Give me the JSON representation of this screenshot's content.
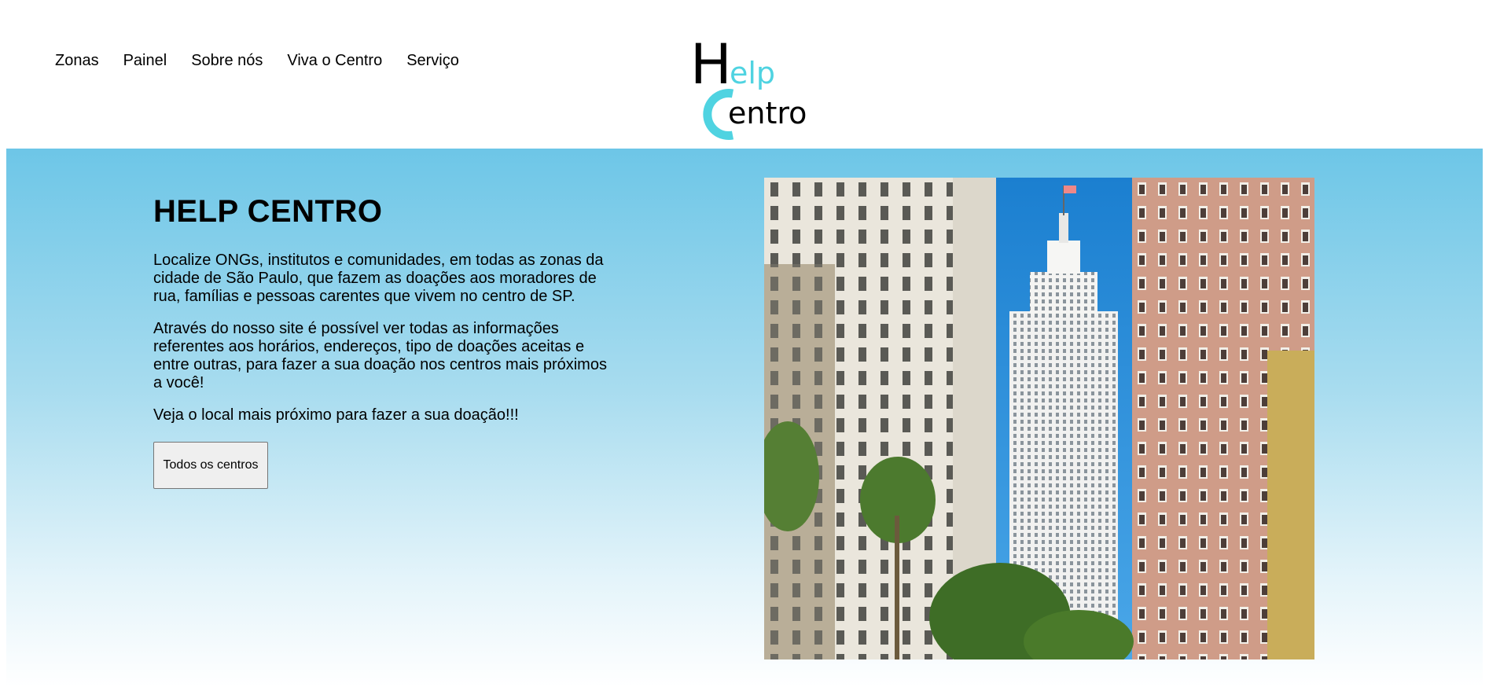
{
  "nav": {
    "items": [
      "Zonas",
      "Painel",
      "Sobre nós",
      "Viva o Centro",
      "Serviço"
    ]
  },
  "logo": {
    "line1_initial": "H",
    "line1_rest": "elp",
    "line2_initial": "C",
    "line2_rest": "entro",
    "accent_color": "#4fd3e1"
  },
  "hero": {
    "title": "HELP CENTRO",
    "paragraphs": [
      "Localize ONGs, institutos e comunidades, em todas as zonas da cidade de São Paulo, que fazem as doações aos moradores de rua, famílias e pessoas carentes que vivem no centro de SP.",
      "Através do nosso site é possível ver todas as informações referentes aos horários, endereços, tipo de doações aceitas e entre outras, para fazer a sua doação nos centros mais próximos a você!",
      "Veja o local mais próximo para fazer a sua doação!!!"
    ],
    "button_label": "Todos os centros",
    "gradient_top": "#6dc6e7",
    "gradient_bottom": "#ffffff"
  },
  "photo": {
    "subject": "São Paulo downtown skyline with Altino Arantes building"
  }
}
